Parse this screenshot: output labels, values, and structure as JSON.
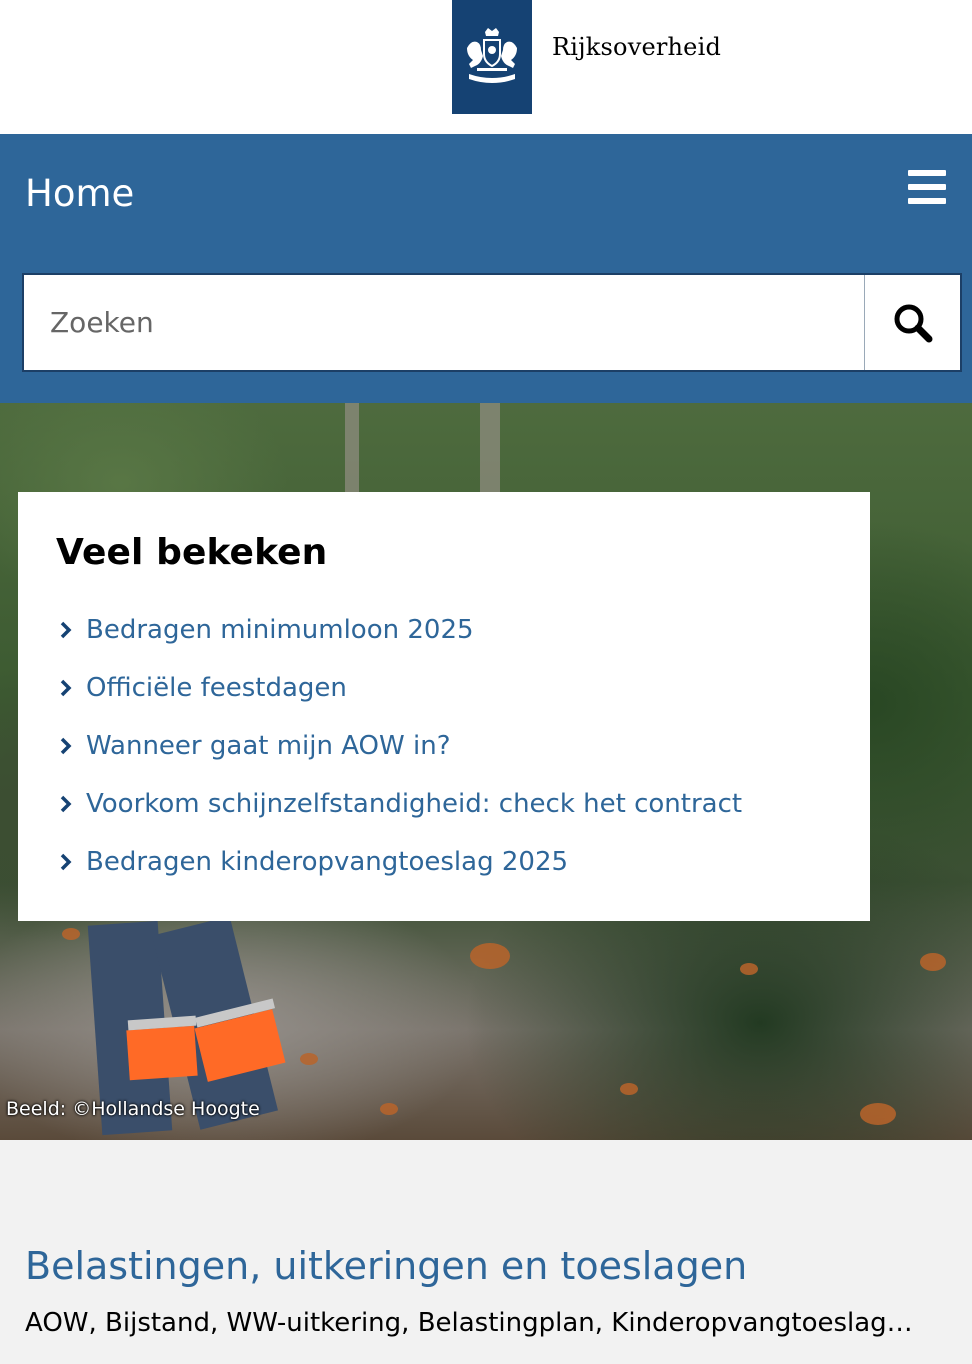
{
  "brand": {
    "name": "Rijksoverheid",
    "colors": {
      "logo_block": "#154273",
      "header_blue": "#2e6699",
      "link": "#2e6699"
    }
  },
  "header": {
    "title": "Home",
    "menu_icon": "hamburger-icon"
  },
  "search": {
    "placeholder": "Zoeken",
    "value": "",
    "icon": "search-icon"
  },
  "popular": {
    "title": "Veel bekeken",
    "items": [
      {
        "label": "Bedragen minimumloon 2025"
      },
      {
        "label": "Officiële feestdagen"
      },
      {
        "label": "Wanneer gaat mijn AOW in?"
      },
      {
        "label": "Voorkom schijnzelfstandigheid: check het contract"
      },
      {
        "label": "Bedragen kinderopvangtoeslag 2025"
      }
    ]
  },
  "hero": {
    "credit": "Beeld: ©Hollandse Hoogte"
  },
  "section": {
    "title": "Belastingen, uitkeringen en toeslagen",
    "subtitle": "AOW, Bijstand, WW-uitkering, Belastingplan, Kinderopvangtoeslag…"
  }
}
